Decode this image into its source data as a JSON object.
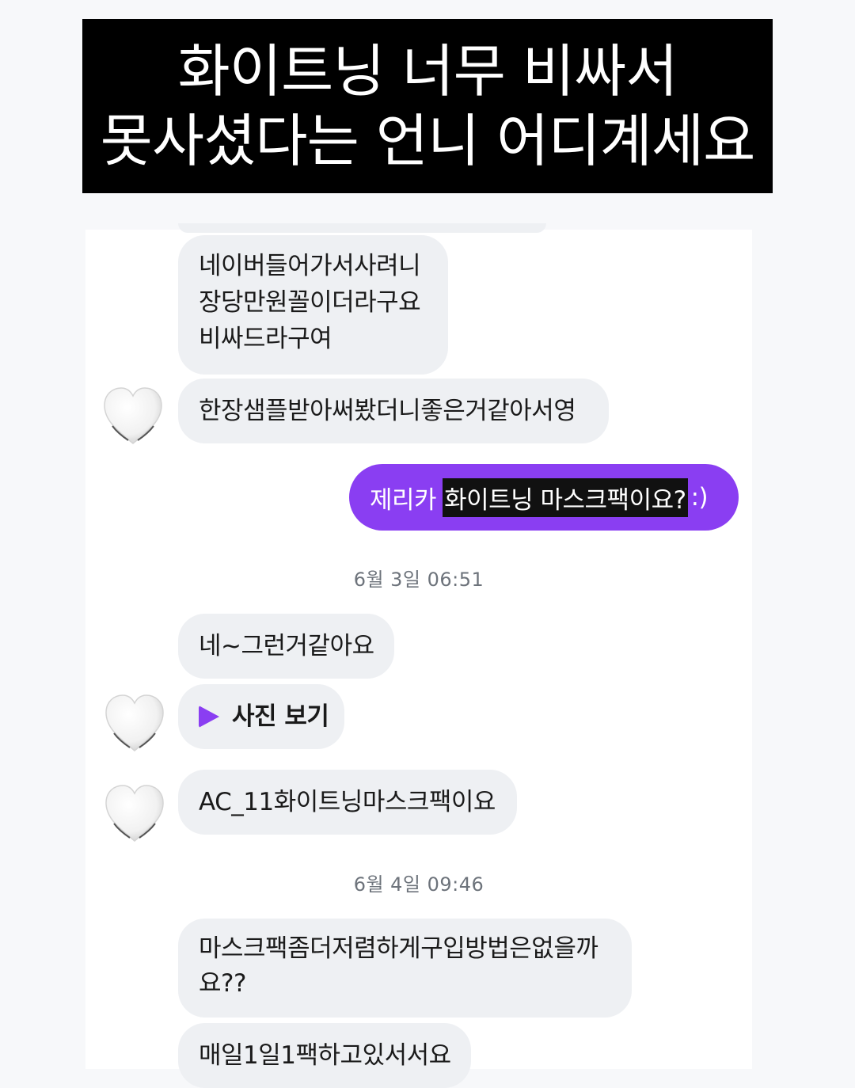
{
  "headline": {
    "line1": "화이트닝 너무 비싸서",
    "line2": "못사셨다는 언니 어디계세요"
  },
  "messages": {
    "m1": "네이버들어가서사려니 장당만원꼴이더라구요 비싸드라구여",
    "m2": "한장샘플받아써봤더니좋은거같아서영",
    "sent_prefix": "제리카",
    "sent_highlight": "화이트닝 마스크팩이요?",
    "sent_suffix": ":)",
    "m3": "네~그런거같아요",
    "photo_label": "사진 보기",
    "m4": "AC_11화이트닝마스크팩이요",
    "m5": "마스크팩좀더저렴하게구입방법은없을까요??",
    "m6": "매일1일1팩하고있서서요"
  },
  "timestamps": {
    "t1": "6월 3일 06:51",
    "t2": "6월 4일 09:46"
  },
  "icons": {
    "avatar": "white-heart-icon",
    "play": "play-icon"
  },
  "colors": {
    "accent": "#8a3ef2",
    "bubble": "#eef0f3",
    "timestamp": "#6d737b"
  }
}
